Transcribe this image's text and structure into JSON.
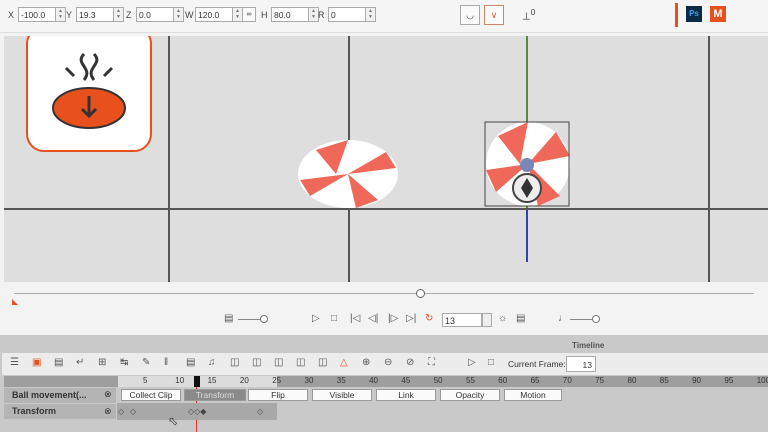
{
  "toolbar": {
    "fields": [
      {
        "label": "X",
        "value": "-100.0"
      },
      {
        "label": "Y",
        "value": "19.3"
      },
      {
        "label": "Z",
        "value": "0.0"
      },
      {
        "label": "W",
        "value": "120.0"
      },
      {
        "label": "H",
        "value": "80.0"
      },
      {
        "label": "R",
        "value": "0"
      }
    ],
    "link_icon": "link-icon",
    "apps": [
      "Ps",
      "M"
    ],
    "snap_label": "0"
  },
  "playback": {
    "frame": "13"
  },
  "timeline": {
    "title": "Timeline",
    "current_frame_label": "Current Frame:",
    "current_frame": "13",
    "ruler": [
      "5",
      "10",
      "15",
      "20",
      "25",
      "30",
      "35",
      "40",
      "45",
      "50",
      "55",
      "60",
      "65",
      "70",
      "75",
      "80",
      "85",
      "90",
      "95",
      "100"
    ],
    "tracks": [
      {
        "name": "Ball movement(..."
      },
      {
        "name": "Transform"
      }
    ],
    "buttons": [
      "Collect Clip",
      "Transform",
      "Flip",
      "Visible",
      "Link",
      "Opacity",
      "Motion"
    ]
  },
  "colors": {
    "accent": "#e8501e"
  }
}
